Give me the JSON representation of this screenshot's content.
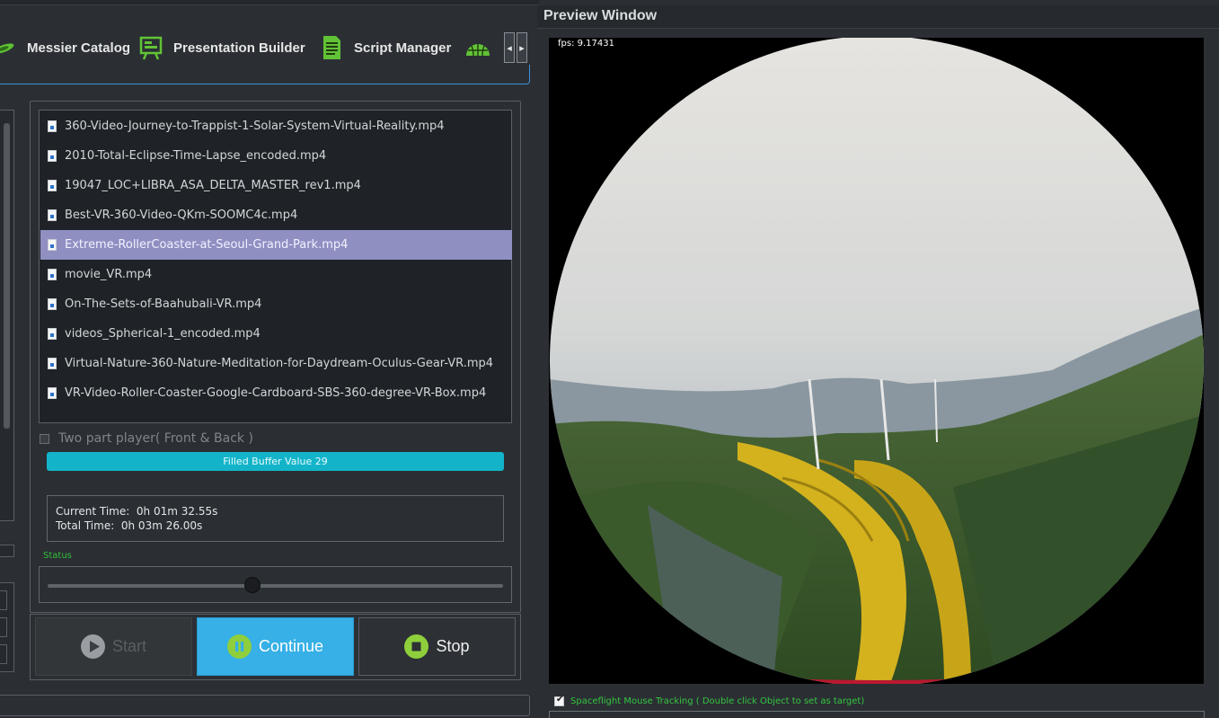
{
  "toolbar": {
    "items": [
      {
        "label": "Messier Catalog",
        "icon": "galaxy-icon"
      },
      {
        "label": "Presentation Builder",
        "icon": "presentation-board-icon"
      },
      {
        "label": "Script Manager",
        "icon": "script-document-icon"
      },
      {
        "label": "",
        "icon": "dome-globe-icon"
      }
    ],
    "scroll_left": "◂",
    "scroll_right": "▸"
  },
  "file_list": {
    "items": [
      "360-Video-Journey-to-Trappist-1-Solar-System-Virtual-Reality.mp4",
      "2010-Total-Eclipse-Time-Lapse_encoded.mp4",
      "19047_LOC+LIBRA_ASA_DELTA_MASTER_rev1.mp4",
      "Best-VR-360-Video-QKm-SOOMC4c.mp4",
      "Extreme-RollerCoaster-at-Seoul-Grand-Park.mp4",
      "movie_VR.mp4",
      "On-The-Sets-of-Baahubali-VR.mp4",
      "videos_Spherical-1_encoded.mp4",
      "Virtual-Nature-360-Nature-Meditation-for-Daydream-Oculus-Gear-VR.mp4",
      "VR-Video-Roller-Coaster-Google-Cardboard-SBS-360-degree-VR-Box.mp4"
    ],
    "selected_index": 4
  },
  "two_part_player": {
    "label": "Two part player( Front & Back )",
    "checked": false
  },
  "buffer": {
    "label": "Filled Buffer Value 29",
    "value": 29
  },
  "time": {
    "current": "Current Time:  0h 01m 32.55s",
    "total": "Total Time:  0h 03m 26.00s"
  },
  "status": {
    "label": "Status",
    "seek_fraction": 0.45
  },
  "controls": {
    "start": "Start",
    "continue": "Continue",
    "stop": "Stop"
  },
  "preview": {
    "title": "Preview Window",
    "fps": "fps: 9.17431"
  },
  "tracking": {
    "label": "Spaceflight Mouse Tracking ( Double click Object to set as target)",
    "checked": true
  },
  "colors": {
    "accent": "#36b0e6",
    "buffer": "#13b4c9",
    "selection": "#8f8fc2",
    "status_green": "#2fbf3a"
  }
}
